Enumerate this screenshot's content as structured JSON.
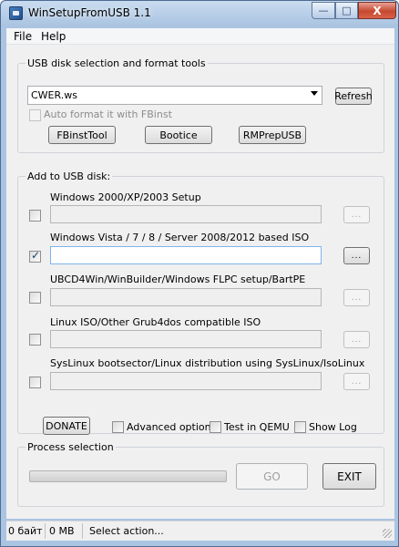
{
  "window": {
    "title": "WinSetupFromUSB 1.1",
    "controls": {
      "minimize": "—",
      "maximize": "□",
      "close": "X"
    }
  },
  "menu": [
    "File",
    "Help"
  ],
  "usb_section": {
    "title": "USB disk selection and format tools",
    "disk_selected": "CWER.ws",
    "refresh_label": "Refresh",
    "auto_format_label": "Auto format it with FBinst",
    "auto_format_checked": false,
    "tools": [
      "FBinstTool",
      "Bootice",
      "RMPrepUSB"
    ]
  },
  "add_section": {
    "title": "Add to USB disk:",
    "browse_label": "...",
    "items": [
      {
        "label": "Windows 2000/XP/2003 Setup",
        "checked": false,
        "enabled": false,
        "value": ""
      },
      {
        "label": "Windows Vista / 7 / 8 / Server 2008/2012 based ISO",
        "checked": true,
        "enabled": true,
        "value": ""
      },
      {
        "label": "UBCD4Win/WinBuilder/Windows FLPC setup/BartPE",
        "checked": false,
        "enabled": false,
        "value": ""
      },
      {
        "label": "Linux ISO/Other Grub4dos compatible ISO",
        "checked": false,
        "enabled": false,
        "value": ""
      },
      {
        "label": "SysLinux bootsector/Linux distribution using SysLinux/IsoLinux",
        "checked": false,
        "enabled": false,
        "value": ""
      }
    ]
  },
  "options": {
    "donate_label": "DONATE",
    "advanced_label": "Advanced options",
    "test_qemu_label": "Test in QEMU",
    "show_log_label": "Show Log"
  },
  "process": {
    "title": "Process selection",
    "progress": 0,
    "go_label": "GO",
    "exit_label": "EXIT"
  },
  "status": {
    "size_bytes": "0 байт",
    "size_mb": "0 MB",
    "message": "Select action..."
  },
  "colors": {
    "accent_focus": "#7eb4ea",
    "check_mark": "#1c3f73",
    "close_button": "#c6492f"
  }
}
